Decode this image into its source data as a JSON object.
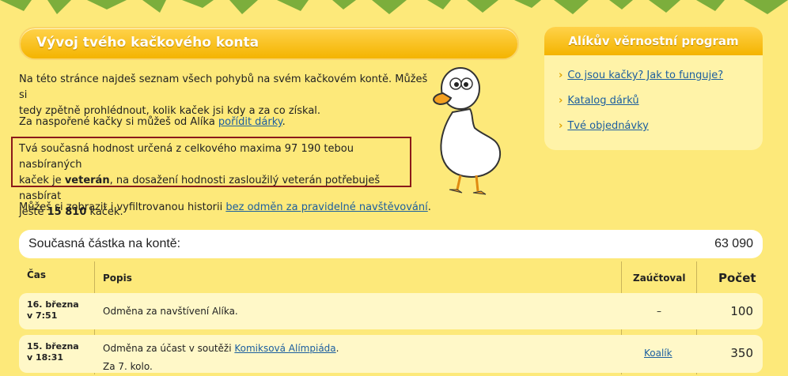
{
  "main": {
    "title": "Vývoj tvého kačkového konta",
    "intro_1": "Na této stránce najdeš seznam všech pohybů na svém kačkovém kontě. Můžeš si",
    "intro_2": "tedy zpětně prohlédnout, kolik kaček jsi kdy a za co získal.",
    "gift_text": "Za naspořené kačky si můžeš od Alíka ",
    "gift_link": "pořídit dárky",
    "status_line_1": "Tvá současná hodnost určená z celkového maxima 97 190 tebou nasbíraných",
    "status_line_2a": "kaček je ",
    "status_rank": "veterán",
    "status_line_2b": ", na dosažení hodnosti zasloužilý veterán potřebuješ nasbírat",
    "status_line_3a": "ještě ",
    "status_needed": "15 810",
    "status_line_3b": " kaček.",
    "filter_text": "Můžeš si zobrazit i vyfiltrovanou historii ",
    "filter_link": "bez odměn za pravidelné navštěvování",
    "filter_end": "."
  },
  "sidebar": {
    "title": "Alíkův věrnostní program",
    "links": [
      "Co jsou kačky? Jak to funguje?",
      "Katalog dárků",
      "Tvé objednávky"
    ]
  },
  "balance": {
    "label": "Současná částka na kontě:",
    "value": "63 090"
  },
  "table": {
    "headers": {
      "time": "Čas",
      "desc": "Popis",
      "booked": "Zaúčtoval",
      "count": "Počet"
    },
    "rows": [
      {
        "date": "16. března",
        "time": "v 7:51",
        "desc": "Odměna za navštívení Alíka.",
        "booked": "–",
        "count": "100"
      },
      {
        "date": "15. března",
        "time": "v 18:31",
        "desc": "Odměna za účast v soutěži ",
        "desc_link": "Komiksová Alímpiáda",
        "desc_end": ".",
        "desc_2": "Za 7. kolo.",
        "booked": "Koalík",
        "count": "350"
      }
    ]
  }
}
